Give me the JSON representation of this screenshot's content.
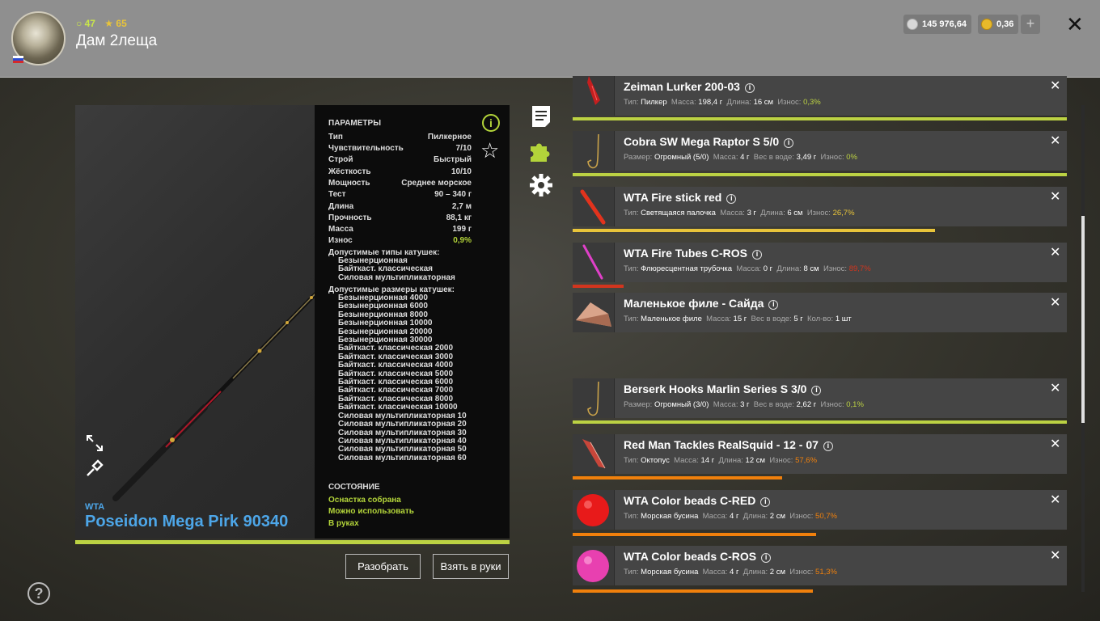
{
  "player": {
    "level": "47",
    "stars": "65",
    "name": "Дам 2леща"
  },
  "currency": {
    "silver": "145 976,64",
    "gold": "0,36",
    "add": "+"
  },
  "close": "✕",
  "rod": {
    "brand": "WTA",
    "name": "Poseidon Mega Pirk 90340",
    "params_title": "ПАРАМЕТРЫ",
    "params": [
      {
        "label": "Тип",
        "value": "Пилкерное"
      },
      {
        "label": "Чувствительность",
        "value": "7/10"
      },
      {
        "label": "Строй",
        "value": "Быстрый"
      },
      {
        "label": "Жёсткость",
        "value": "10/10"
      },
      {
        "label": "Мощность",
        "value": "Среднее морское"
      },
      {
        "label": "Тест",
        "value": "90 – 340 г"
      },
      {
        "label": "Длина",
        "value": "2,7 м"
      },
      {
        "label": "Прочность",
        "value": "88,1 кг"
      },
      {
        "label": "Масса",
        "value": "199 г"
      },
      {
        "label": "Износ",
        "value": "0,9%"
      }
    ],
    "reel_types_title": "Допустимые типы катушек:",
    "reel_types": "Безынерционная\nБайткаст. классическая\nСиловая мультипликаторная",
    "reel_sizes_title": "Допустимые размеры катушек:",
    "reel_sizes": "Безынерционная 4000\nБезынерционная 6000\nБезынерционная 8000\nБезынерционная 10000\nБезынерционная 20000\nБезынерционная 30000\nБайткаст. классическая 2000\nБайткаст. классическая 3000\nБайткаст. классическая 4000\nБайткаст. классическая 5000\nБайткаст. классическая 6000\nБайткаст. классическая 7000\nБайткаст. классическая 8000\nБайткаст. классическая 10000\nСиловая мультипликаторная 10\nСиловая мультипликаторная 20\nСиловая мультипликаторная 30\nСиловая мультипликаторная 40\nСиловая мультипликаторная 50\nСиловая мультипликаторная 60",
    "state_title": "СОСТОЯНИЕ",
    "states": [
      "Оснастка собрана",
      "Можно использовать",
      "В руках"
    ],
    "wear_fraction": 0.991
  },
  "buttons": {
    "disassemble": "Разобрать",
    "take": "Взять в руки"
  },
  "help": "?",
  "colors": {
    "accent_green": "#bcd243",
    "wear_orange": "#f0800c",
    "wear_red": "#d2351e",
    "wear_yellow": "#e8c43a",
    "brand_blue": "#4da6e8"
  },
  "items": [
    {
      "name": "Zeiman Lurker 200-03",
      "p1l": "Тип:",
      "p1v": "Пилкер",
      "p2l": "Масса:",
      "p2v": "198,4 г",
      "p3l": "Длина:",
      "p3v": "16 см",
      "wl": "Износ:",
      "wv": "0,3%",
      "wear_color": "#bcd243",
      "wear_fraction": 0.997,
      "icon": "jig-lure-icon"
    },
    {
      "name": "Cobra SW Mega Raptor S 5/0",
      "p1l": "Размер:",
      "p1v": "Огромный (5/0)",
      "p2l": "Масса:",
      "p2v": "4 г",
      "p3l": "Вес в воде:",
      "p3v": "3,49 г",
      "wl": "Износ:",
      "wv": "0%",
      "wear_color": "#bcd243",
      "wear_fraction": 1.0,
      "icon": "hook-icon"
    },
    {
      "name": "WTA Fire stick red",
      "p1l": "Тип:",
      "p1v": "Светящаяся палочка",
      "p2l": "Масса:",
      "p2v": "3 г",
      "p3l": "Длина:",
      "p3v": "6 см",
      "wl": "Износ:",
      "wv": "26,7%",
      "wear_color": "#e8c43a",
      "wear_fraction": 0.733,
      "icon": "glow-stick-icon"
    },
    {
      "name": "WTA Fire Tubes C-ROS",
      "p1l": "Тип:",
      "p1v": "Флюресцентная трубочка",
      "p2l": "Масса:",
      "p2v": "0 г",
      "p3l": "Длина:",
      "p3v": "8 см",
      "wl": "Износ:",
      "wv": "89,7%",
      "wear_color": "#d2351e",
      "wear_fraction": 0.103,
      "icon": "fire-tube-icon"
    },
    {
      "name": "Маленькое филе - Сайда",
      "p1l": "Тип:",
      "p1v": "Маленькое филе",
      "p2l": "Масса:",
      "p2v": "15 г",
      "p3l": "Вес в воде:",
      "p3v": "5 г",
      "wl": "Кол-во:",
      "wv": "1 шт",
      "wear_color": "",
      "wear_fraction": 0,
      "icon": "fish-fillet-icon"
    },
    {
      "name": "Berserk Hooks Marlin Series S 3/0",
      "p1l": "Размер:",
      "p1v": "Огромный (3/0)",
      "p2l": "Масса:",
      "p2v": "3 г",
      "p3l": "Вес в воде:",
      "p3v": "2,62 г",
      "wl": "Износ:",
      "wv": "0,1%",
      "wear_color": "#bcd243",
      "wear_fraction": 0.999,
      "icon": "hook-icon"
    },
    {
      "name": "Red Man Tackles RealSquid - 12 - 07",
      "p1l": "Тип:",
      "p1v": "Октопус",
      "p2l": "Масса:",
      "p2v": "14 г",
      "p3l": "Длина:",
      "p3v": "12 см",
      "wl": "Износ:",
      "wv": "57,6%",
      "wear_color": "#f0800c",
      "wear_fraction": 0.424,
      "icon": "squid-lure-icon"
    },
    {
      "name": "WTA Color beads C-RED",
      "p1l": "Тип:",
      "p1v": "Морская бусина",
      "p2l": "Масса:",
      "p2v": "4 г",
      "p3l": "Длина:",
      "p3v": "2 см",
      "wl": "Износ:",
      "wv": "50,7%",
      "wear_color": "#f0800c",
      "wear_fraction": 0.493,
      "icon": "red-bead-icon"
    },
    {
      "name": "WTA Color beads C-ROS",
      "p1l": "Тип:",
      "p1v": "Морская бусина",
      "p2l": "Масса:",
      "p2v": "4 г",
      "p3l": "Длина:",
      "p3v": "2 см",
      "wl": "Износ:",
      "wv": "51,3%",
      "wear_color": "#f0800c",
      "wear_fraction": 0.487,
      "icon": "pink-bead-icon"
    }
  ]
}
